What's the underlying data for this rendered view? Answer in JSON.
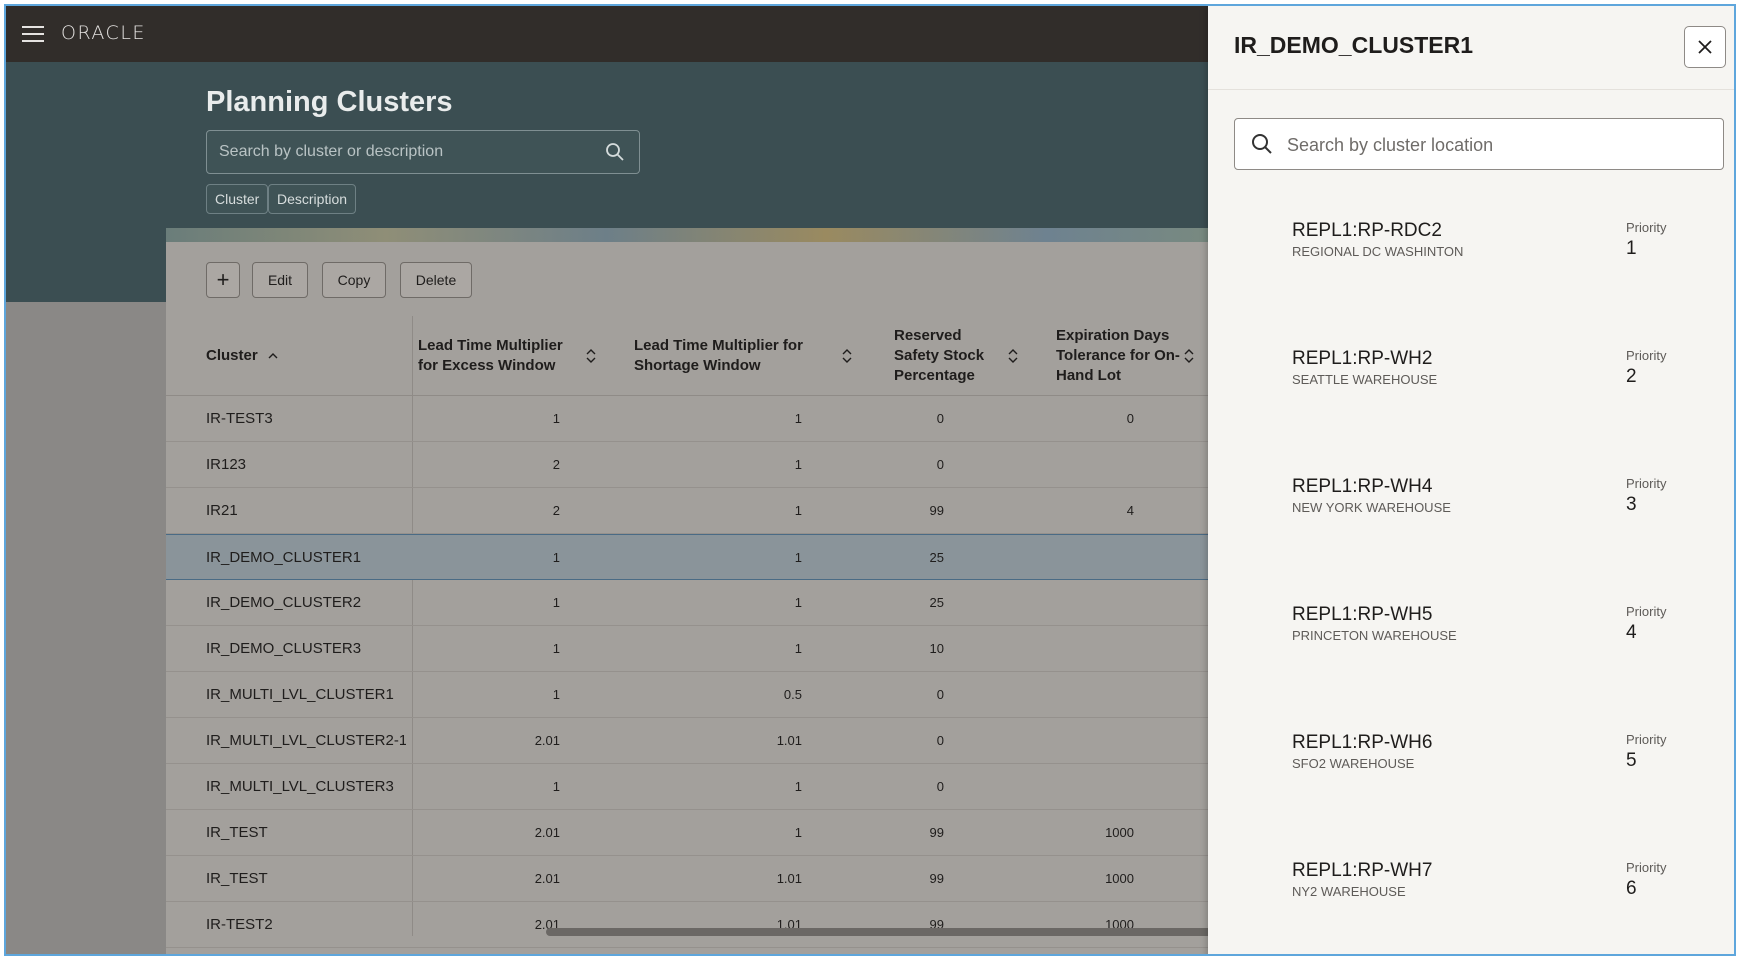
{
  "header": {
    "logo_text": "ORACLE"
  },
  "page": {
    "title": "Planning Clusters",
    "search_placeholder": "Search by cluster or description",
    "filter_chips": [
      "Cluster",
      "Description"
    ]
  },
  "toolbar": {
    "add_label": "+",
    "edit_label": "Edit",
    "copy_label": "Copy",
    "delete_label": "Delete"
  },
  "table": {
    "columns": [
      "Cluster",
      "Lead Time Multiplier for Excess Window",
      "Lead Time Multiplier for Shortage Window",
      "Reserved Safety Stock Percentage",
      "Expiration Days Tolerance for On-Hand Lot"
    ],
    "sort_column": "Cluster",
    "sort_direction": "ascending",
    "selected_row": "IR_DEMO_CLUSTER1",
    "rows": [
      [
        "IR-TEST3",
        "1",
        "1",
        "0",
        "0"
      ],
      [
        "IR123",
        "2",
        "1",
        "0",
        ""
      ],
      [
        "IR21",
        "2",
        "1",
        "99",
        "4"
      ],
      [
        "IR_DEMO_CLUSTER1",
        "1",
        "1",
        "25",
        ""
      ],
      [
        "IR_DEMO_CLUSTER2",
        "1",
        "1",
        "25",
        ""
      ],
      [
        "IR_DEMO_CLUSTER3",
        "1",
        "1",
        "10",
        ""
      ],
      [
        "IR_MULTI_LVL_CLUSTER1",
        "1",
        "0.5",
        "0",
        ""
      ],
      [
        "IR_MULTI_LVL_CLUSTER2-1",
        "2.01",
        "1.01",
        "0",
        ""
      ],
      [
        "IR_MULTI_LVL_CLUSTER3",
        "1",
        "1",
        "0",
        ""
      ],
      [
        "IR_TEST",
        "2.01",
        "1",
        "99",
        "1000"
      ],
      [
        "IR_TEST",
        "2.01",
        "1.01",
        "99",
        "1000"
      ],
      [
        "IR-TEST2",
        "2.01",
        "1.01",
        "99",
        "1000"
      ]
    ]
  },
  "drawer": {
    "title": "IR_DEMO_CLUSTER1",
    "search_placeholder": "Search by cluster location",
    "priority_label": "Priority",
    "locations": [
      {
        "name": "REPL1:RP-RDC2",
        "description": "REGIONAL DC WASHINTON",
        "priority": "1"
      },
      {
        "name": "REPL1:RP-WH2",
        "description": "SEATTLE WAREHOUSE",
        "priority": "2"
      },
      {
        "name": "REPL1:RP-WH4",
        "description": "NEW YORK WAREHOUSE",
        "priority": "3"
      },
      {
        "name": "REPL1:RP-WH5",
        "description": "PRINCETON WAREHOUSE",
        "priority": "4"
      },
      {
        "name": "REPL1:RP-WH6",
        "description": "SFO2 WAREHOUSE",
        "priority": "5"
      },
      {
        "name": "REPL1:RP-WH7",
        "description": "NY2 WAREHOUSE",
        "priority": "6"
      }
    ]
  }
}
